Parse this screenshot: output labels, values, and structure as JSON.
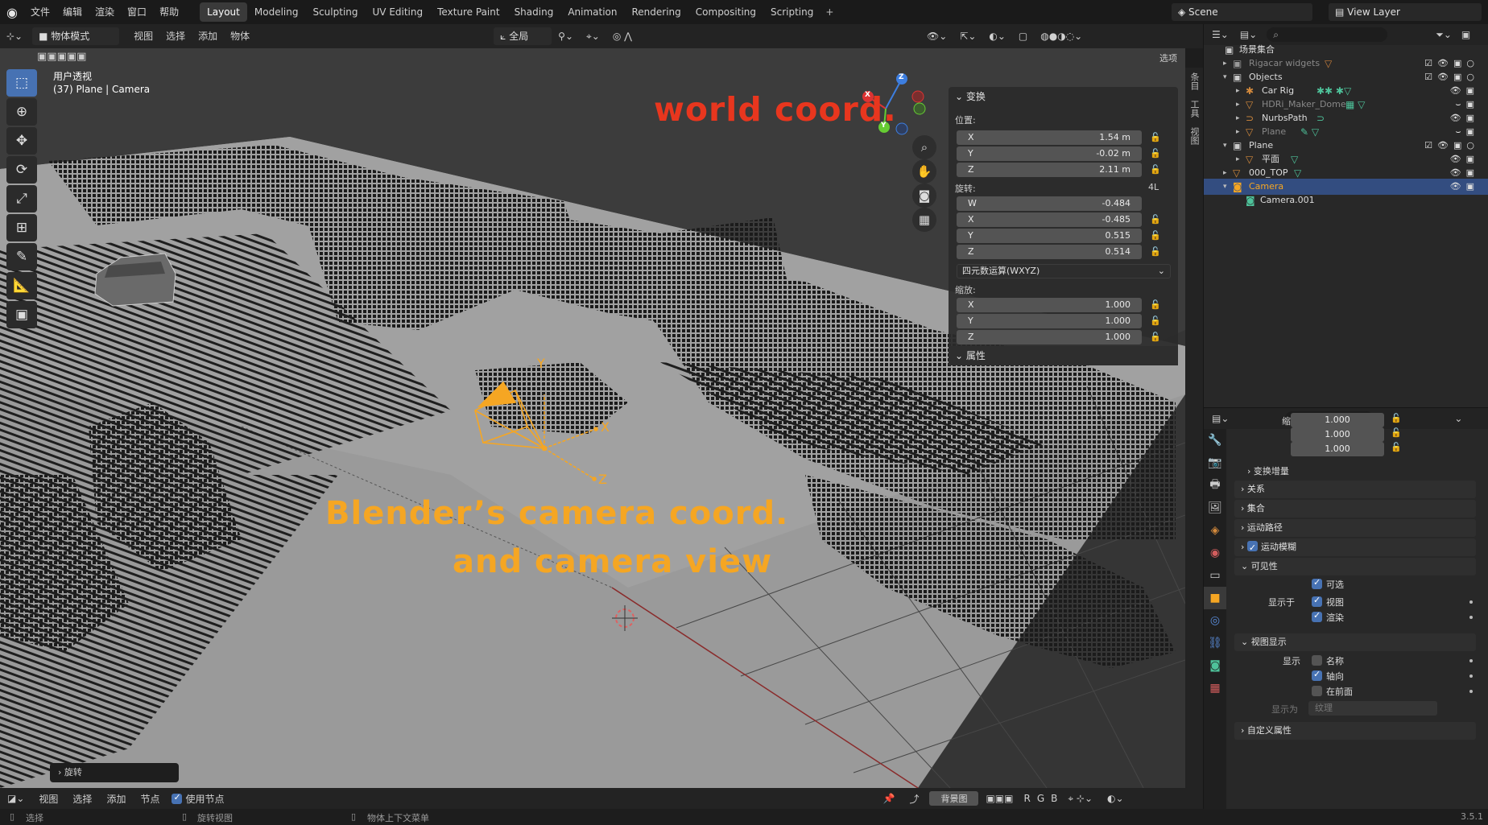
{
  "menu": {
    "items": [
      "文件",
      "编辑",
      "渲染",
      "窗口",
      "帮助"
    ]
  },
  "workspaces": [
    "Layout",
    "Modeling",
    "Sculpting",
    "UV Editing",
    "Texture Paint",
    "Shading",
    "Animation",
    "Rendering",
    "Compositing",
    "Scripting"
  ],
  "active_workspace": "Layout",
  "scene": "Scene",
  "view_layer": "View Layer",
  "viewport_header": {
    "mode": "物体模式",
    "menus": [
      "视图",
      "选择",
      "添加",
      "物体"
    ],
    "orientation": "全局",
    "options": "选项"
  },
  "viewport_overlay": {
    "view_name": "用户透视",
    "object_info": "(37) Plane | Camera"
  },
  "annotations": {
    "world": "world coord.",
    "camera_line1": "Blender’s camera coord.",
    "camera_line2": "and camera view"
  },
  "axis_labels": {
    "x": "X",
    "y": "Y",
    "z": "Z"
  },
  "npanel": {
    "transform_title": "变换",
    "location_label": "位置:",
    "location": [
      {
        "axis": "X",
        "value": "1.54 m"
      },
      {
        "axis": "Y",
        "value": "-0.02 m"
      },
      {
        "axis": "Z",
        "value": "2.11 m"
      }
    ],
    "rotation_label": "旋转:",
    "rotation_badge": "4L",
    "rotation": [
      {
        "axis": "W",
        "value": "-0.484"
      },
      {
        "axis": "X",
        "value": "-0.485"
      },
      {
        "axis": "Y",
        "value": "0.515"
      },
      {
        "axis": "Z",
        "value": "0.514"
      }
    ],
    "rotation_mode": "四元数运算(WXYZ)",
    "scale_label": "缩放:",
    "scale": [
      {
        "axis": "X",
        "value": "1.000"
      },
      {
        "axis": "Y",
        "value": "1.000"
      },
      {
        "axis": "Z",
        "value": "1.000"
      }
    ],
    "properties_title": "属性",
    "tabs": [
      "条目",
      "工具",
      "视图"
    ]
  },
  "last_operator": "旋转",
  "bottom_header": {
    "menus": [
      "视图",
      "选择",
      "添加",
      "节点"
    ],
    "use_nodes": "使用节点",
    "background": "背景图",
    "channels": [
      "R",
      "G",
      "B"
    ]
  },
  "statusbar": {
    "select": "选择",
    "rotate": "旋转视图",
    "context": "物体上下文菜单",
    "version": "3.5.1"
  },
  "outliner": {
    "root": "场景集合",
    "rows": [
      {
        "name": "Rigacar widgets",
        "badge": "9"
      },
      {
        "name": "Objects"
      },
      {
        "name": "Car Rig",
        "badge": "9"
      },
      {
        "name": "HDRi_Maker_Dome"
      },
      {
        "name": "NurbsPath"
      },
      {
        "name": "Plane"
      },
      {
        "name": "Plane"
      },
      {
        "name": "平面"
      },
      {
        "name": "000_TOP"
      },
      {
        "name": "Camera"
      },
      {
        "name": "Camera.001"
      }
    ]
  },
  "properties": {
    "scale_rows": [
      {
        "axis": "缩放 X",
        "value": "1.000"
      },
      {
        "axis": "Y",
        "value": "1.000"
      },
      {
        "axis": "Z",
        "value": "1.000"
      }
    ],
    "delta_transform": "变换增量",
    "sections": [
      "关系",
      "集合",
      "运动路径",
      "运动模糊",
      "可见性"
    ],
    "visibility": {
      "selectable": "可选",
      "show_in": "显示于",
      "viewport": "视图",
      "render": "渲染"
    },
    "viewport_display": {
      "title": "视图显示",
      "show": "显示",
      "name": "名称",
      "axes": "轴向",
      "in_front": "在前面",
      "display_as": "显示为",
      "display_as_value": "纹理"
    },
    "custom_props": "自定义属性"
  },
  "colors": {
    "accent": "#4772b3",
    "camera_orange": "#f5a623",
    "world_red": "#e8361e",
    "selected_row": "#334d80"
  }
}
